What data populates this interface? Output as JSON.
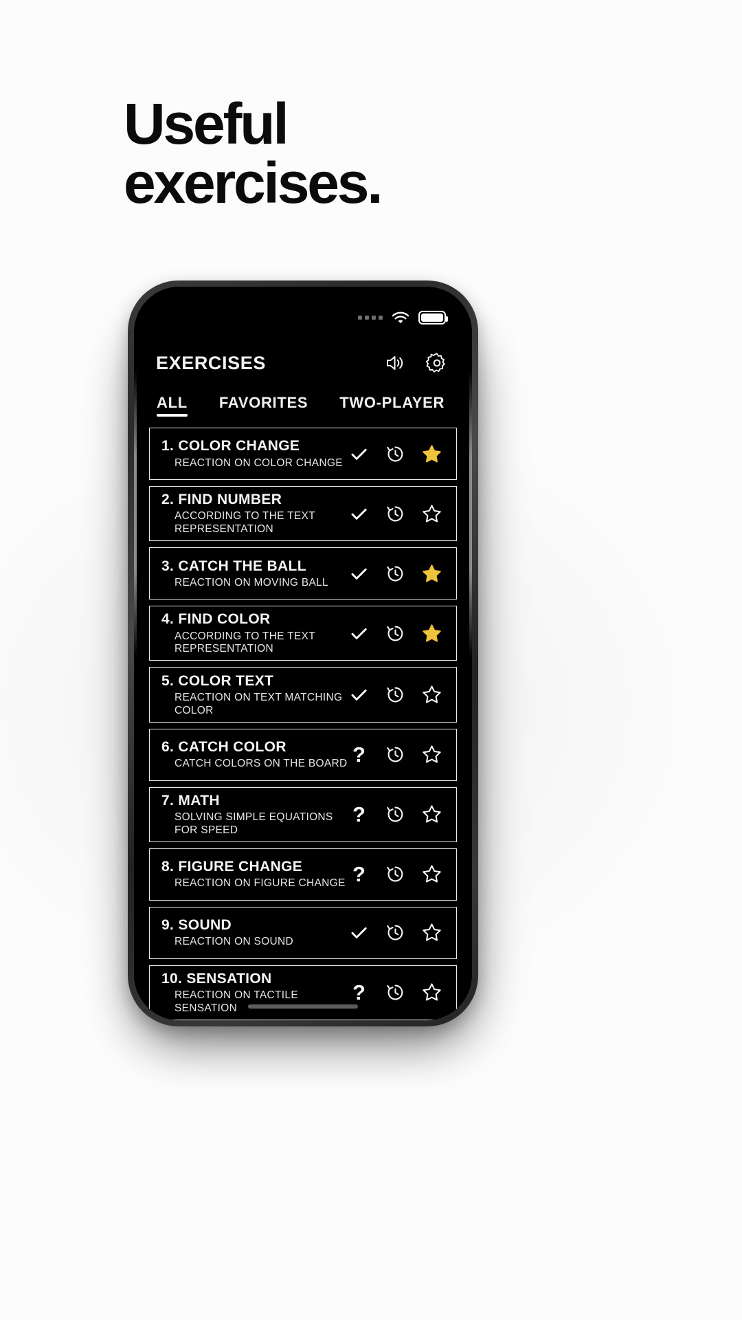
{
  "page": {
    "headline": "Useful\nexercises.",
    "background_color": "#fbfbfc",
    "text_color": "#0b0b0c"
  },
  "phone": {
    "status_bar": {
      "signal_icon": "signal-dots-icon",
      "signal_bars": 4,
      "wifi_icon": "wifi-icon",
      "battery_icon": "battery-full-icon",
      "battery_level_percent": 100
    },
    "home_indicator": "home-indicator-bar"
  },
  "header": {
    "title": "EXERCISES",
    "actions": [
      {
        "name": "sound-icon",
        "label": "Sound"
      },
      {
        "name": "gear-icon",
        "label": "Settings"
      }
    ]
  },
  "tabs": [
    {
      "label": "ALL",
      "active": true
    },
    {
      "label": "FAVORITES",
      "active": false
    },
    {
      "label": "TWO-PLAYER",
      "active": false
    }
  ],
  "colors": {
    "screen_background": "#000000",
    "row_border": "#e9e9ea",
    "text_primary": "#f4f4f5",
    "star_filled": "#f0c33c",
    "star_empty": "#ffffff",
    "accent_underline": "#ffffff"
  },
  "exercises": [
    {
      "number": "1.",
      "title": "COLOR CHANGE",
      "subtitle": "REACTION ON COLOR CHANGE",
      "status": "check",
      "history": "history-icon",
      "favorite": true
    },
    {
      "number": "2.",
      "title": "FIND NUMBER",
      "subtitle": "ACCORDING TO THE TEXT\nREPRESENTATION",
      "status": "check",
      "history": "history-icon",
      "favorite": false
    },
    {
      "number": "3.",
      "title": "CATCH THE BALL",
      "subtitle": "REACTION ON MOVING BALL",
      "status": "check",
      "history": "history-icon",
      "favorite": true
    },
    {
      "number": "4.",
      "title": "FIND COLOR",
      "subtitle": "ACCORDING TO THE TEXT\nREPRESENTATION",
      "status": "check",
      "history": "history-icon",
      "favorite": true
    },
    {
      "number": "5.",
      "title": "COLOR TEXT",
      "subtitle": "REACTION ON TEXT MATCHING COLOR",
      "status": "check",
      "history": "history-icon",
      "favorite": false
    },
    {
      "number": "6.",
      "title": "CATCH COLOR",
      "subtitle": "CATCH COLORS ON THE BOARD",
      "status": "question",
      "history": "history-icon",
      "favorite": false
    },
    {
      "number": "7.",
      "title": "MATH",
      "subtitle": "SOLVING SIMPLE EQUATIONS\nFOR SPEED",
      "status": "question",
      "history": "history-icon",
      "favorite": false
    },
    {
      "number": "8.",
      "title": "FIGURE CHANGE",
      "subtitle": "REACTION ON FIGURE CHANGE",
      "status": "question",
      "history": "history-icon",
      "favorite": false
    },
    {
      "number": "9.",
      "title": "SOUND",
      "subtitle": "REACTION ON SOUND",
      "status": "check",
      "history": "history-icon",
      "favorite": false
    },
    {
      "number": "10.",
      "title": "SENSATION",
      "subtitle": "REACTION ON TACTILE SENSATION",
      "status": "question",
      "history": "history-icon",
      "favorite": false
    }
  ],
  "status_symbols": {
    "check": "check-icon",
    "question": "?"
  }
}
